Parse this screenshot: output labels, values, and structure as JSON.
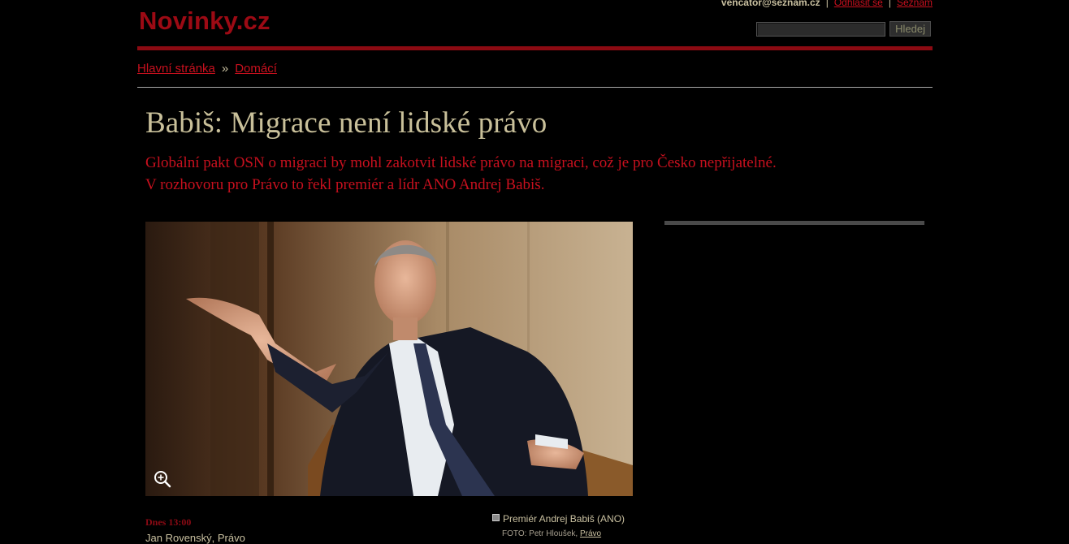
{
  "header": {
    "logo": "Novinky.cz",
    "user_email": "vencator@seznam.cz",
    "logout_label": "Odhlásit se",
    "seznam_label": "Seznam",
    "separator": "|",
    "search_button": "Hledej",
    "search_value": ""
  },
  "breadcrumb": {
    "home": "Hlavní stránka",
    "arrow": "»",
    "section": "Domácí"
  },
  "article": {
    "title": "Babiš: Migrace není lidské právo",
    "perex_line1": "Globální pakt OSN o migraci by mohl zakotvit lidské právo na migraci, což je pro Česko nepřijatelné.",
    "perex_line2": "V rozhovoru pro Právo to řekl premiér a lídr ANO Andrej Babiš.",
    "date": "Dnes 13:00",
    "author": "Jan Rovenský, Právo",
    "photo_caption": "Premiér Andrej Babiš (ANO)",
    "photo_credit_prefix": "FOTO: Petr Hloušek,",
    "photo_credit_source": "Právo"
  },
  "colors": {
    "background": "#000000",
    "accent_red": "#c8101e",
    "logo_red": "#9c0a14",
    "text_beige": "#c9c0a0"
  }
}
